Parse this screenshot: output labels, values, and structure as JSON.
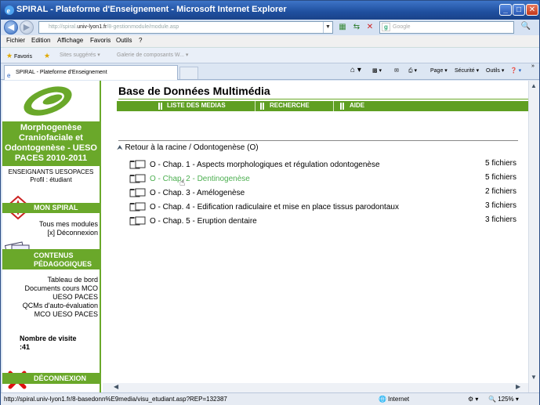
{
  "window": {
    "title": "SPIRAL - Plateforme d'Enseignement - Microsoft Internet Explorer",
    "min": "_",
    "max": "□",
    "close": "✕"
  },
  "address": {
    "url_prefix": "http://spiral.",
    "url_host": "univ-lyon1.fr",
    "url_suffix": "/8-gestionmodule/module.asp",
    "search_placeholder": "Google"
  },
  "menu": [
    "Fichier",
    "Edition",
    "Affichage",
    "Favoris",
    "Outils",
    "?"
  ],
  "favorites": {
    "label": "Favoris",
    "suggested": "Sites suggérés",
    "gallery": "Galerie de composants W..."
  },
  "tab": {
    "title": "SPIRAL - Plateforme d'Enseignement"
  },
  "commands": {
    "page": "Page",
    "security": "Sécurité",
    "tools": "Outils",
    "more": "»"
  },
  "sidebar": {
    "course": "Morphogenèse Craniofaciale et Odontogenèse - UESO PACES 2010-2011",
    "teacher_line1": "ENSEIGNANTS UESOPACES",
    "teacher_line2": "Profil : étudiant",
    "mon_spiral": {
      "title": "MON SPIRAL",
      "links": [
        "Tous mes modules",
        "[x]  Déconnexion"
      ]
    },
    "contenus": {
      "title_line1": "CONTENUS",
      "title_line2": "PÉDAGOGIQUES",
      "links": [
        "Tableau de bord",
        "Documents cours MCO UESO PACES",
        "QCMs d'auto-évaluation MCO UESO PACES"
      ]
    },
    "visits_label": "Nombre de visite :",
    "visits_value": "41",
    "logout": "DÉCONNEXION"
  },
  "main": {
    "title": "Base de Données Multimédia",
    "nav": [
      "LISTE DES MEDIAS",
      "RECHERCHE",
      "AIDE"
    ],
    "breadcrumb_root": "Retour à la racine",
    "breadcrumb_sep": " / ",
    "breadcrumb_current": "Odontogenèse (O)",
    "folders": [
      {
        "label": "O - Chap. 1 - Aspects morphologiques et régulation odontogenèse",
        "count": "5 fichiers"
      },
      {
        "label": "O - Chap. 2 - Dentinogenèse",
        "count": "5 fichiers"
      },
      {
        "label": "O - Chap. 3 - Amélogenèse",
        "count": "2 fichiers"
      },
      {
        "label": "O - Chap. 4 - Edification radiculaire et mise en place tissus parodontaux",
        "count": "3 fichiers"
      },
      {
        "label": "O - Chap. 5 - Eruption dentaire",
        "count": "3 fichiers"
      }
    ]
  },
  "status": {
    "url": "http://spiral.univ-lyon1.fr/8-basedonn%E9media/visu_etudiant.asp?REP=132387",
    "zone": "Internet",
    "zoom": "125%"
  },
  "colors": {
    "green": "#6aa82a",
    "title_blue": "#1f4f9e"
  }
}
